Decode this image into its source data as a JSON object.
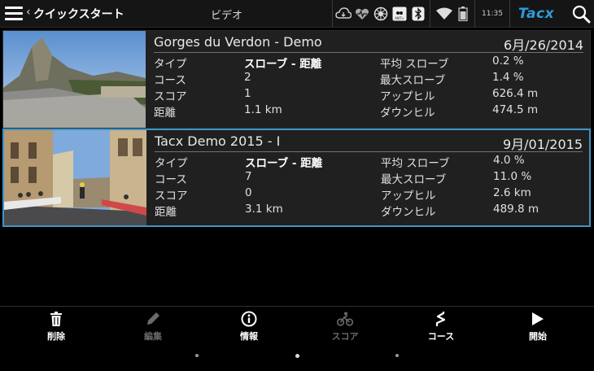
{
  "header": {
    "app_title": "クイックスタート",
    "center_title": "ビデオ",
    "clock": "11:35",
    "brand": "Tacx",
    "ant_label": "ANT+"
  },
  "videos": [
    {
      "title": "Gorges du Verdon - Demo",
      "date": "6月/26/2014",
      "rows": [
        [
          "タイプ",
          "スローブ - 距離",
          "平均 スローブ",
          "0.2 %"
        ],
        [
          "コース",
          "2",
          "最大スローブ",
          "1.4 %"
        ],
        [
          "スコア",
          "1",
          "アップヒル",
          "626.4 m"
        ],
        [
          "距離",
          "1.1 km",
          "ダウンヒル",
          "474.5 m"
        ]
      ]
    },
    {
      "title": "Tacx Demo 2015 - I",
      "date": "9月/01/2015",
      "rows": [
        [
          "タイプ",
          "スローブ - 距離",
          "平均 スローブ",
          "4.0 %"
        ],
        [
          "コース",
          "7",
          "最大スローブ",
          "11.0 %"
        ],
        [
          "スコア",
          "0",
          "アップヒル",
          "2.6 km"
        ],
        [
          "距離",
          "3.1 km",
          "ダウンヒル",
          "489.8 m"
        ]
      ]
    }
  ],
  "toolbar": {
    "delete": "削除",
    "edit": "編集",
    "info": "情報",
    "score": "スコア",
    "course": "コース",
    "start": "開始"
  },
  "colors": {
    "accent": "#2e9cdb",
    "selected_border": "#3e95c8"
  }
}
